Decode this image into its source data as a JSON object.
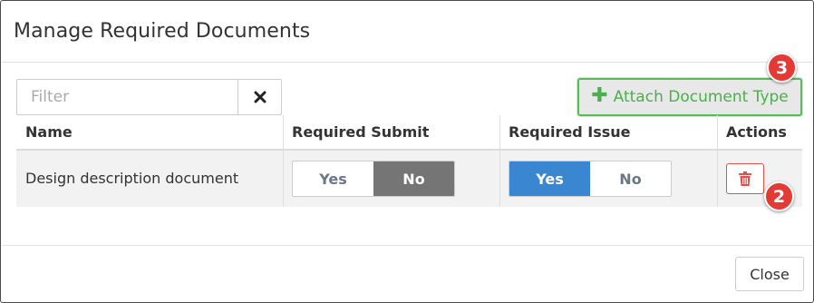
{
  "modal": {
    "title": "Manage Required Documents"
  },
  "filter": {
    "placeholder": "Filter",
    "value": ""
  },
  "toolbar": {
    "attach_label": "Attach Document Type"
  },
  "badges": {
    "attach": "3",
    "delete": "2"
  },
  "table": {
    "headers": {
      "name": "Name",
      "required_submit": "Required Submit",
      "required_issue": "Required Issue",
      "actions": "Actions"
    },
    "rows": [
      {
        "name": "Design description document",
        "required_submit": {
          "yes": "Yes",
          "no": "No",
          "selected": "No"
        },
        "required_issue": {
          "yes": "Yes",
          "no": "No",
          "selected": "Yes"
        }
      }
    ]
  },
  "footer": {
    "close_label": "Close"
  },
  "colors": {
    "attach_green": "#4cae4c",
    "selected_blue": "#3a86d1",
    "selected_grey": "#757575",
    "delete_red": "#d9534f",
    "badge_red": "#e53935"
  },
  "icons": {
    "clear": "x-icon",
    "attach": "plus-icon",
    "delete": "trash-icon"
  }
}
